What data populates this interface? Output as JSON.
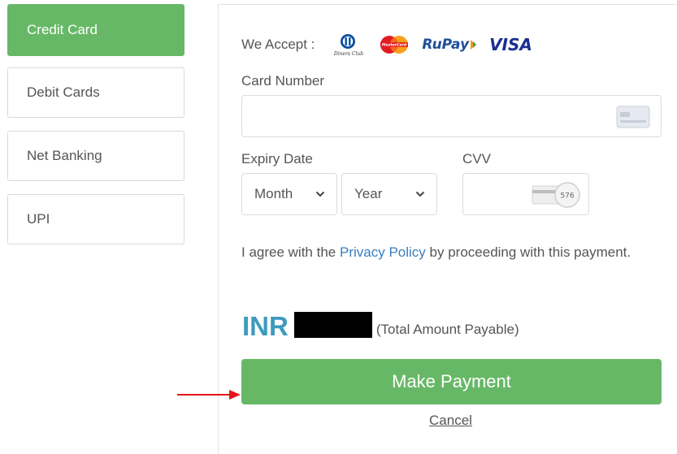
{
  "sidebar": {
    "items": [
      {
        "label": "Credit Card",
        "active": true
      },
      {
        "label": "Debit Cards",
        "active": false
      },
      {
        "label": "Net Banking",
        "active": false
      },
      {
        "label": "UPI",
        "active": false
      }
    ]
  },
  "form": {
    "accept_label": "We Accept :",
    "card_brands": {
      "diners": "Diners Club",
      "mastercard": "MasterCard",
      "rupay": "RuPay",
      "visa": "VISA"
    },
    "card_number_label": "Card Number",
    "card_number_value": "",
    "expiry_label": "Expiry Date",
    "month_value": "Month",
    "year_value": "Year",
    "cvv_label": "CVV",
    "cvv_value": "",
    "cvv_sample": "576",
    "agree_prefix": "I agree with the",
    "privacy_link": "Privacy Policy",
    "agree_suffix": "by proceeding with this payment.",
    "currency": "INR",
    "amount_note": "(Total Amount Payable)",
    "pay_button": "Make Payment",
    "cancel_link": "Cancel"
  },
  "colors": {
    "accent_green": "#67b866",
    "currency_blue": "#3d9bbd",
    "link_blue": "#3a7dbf",
    "arrow_red": "#e8131b"
  }
}
